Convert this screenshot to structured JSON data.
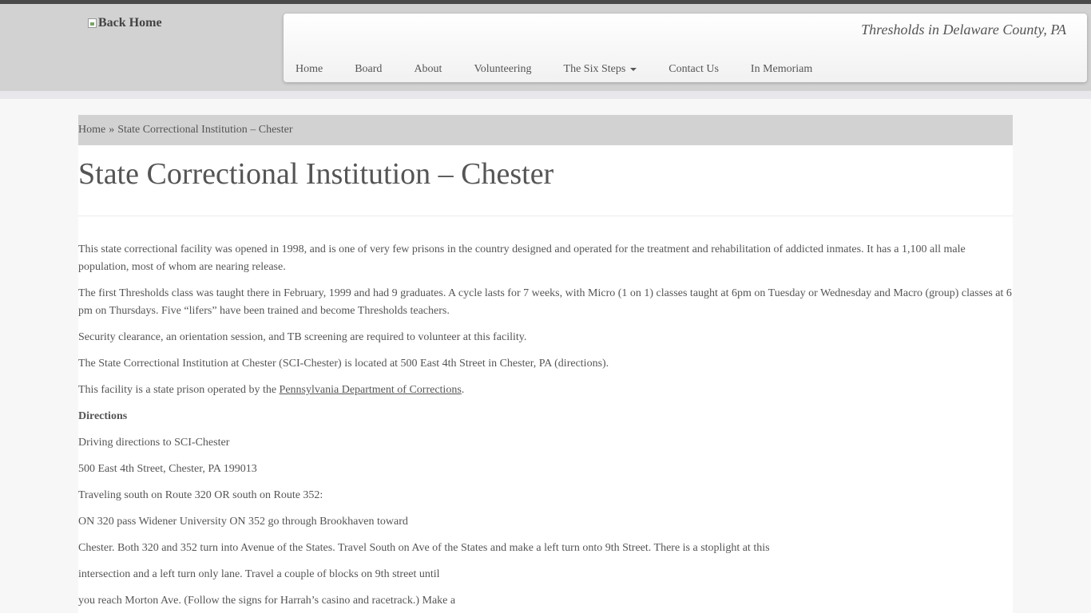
{
  "header": {
    "logo_alt": "Back Home",
    "tagline": "Thresholds in Delaware County, PA"
  },
  "nav": {
    "items": [
      {
        "label": "Home"
      },
      {
        "label": "Board"
      },
      {
        "label": "About"
      },
      {
        "label": "Volunteering"
      },
      {
        "label": "The Six Steps"
      },
      {
        "label": "Contact Us"
      },
      {
        "label": "In Memoriam"
      }
    ]
  },
  "breadcrumb": {
    "home": "Home",
    "separator": "»",
    "current": "State Correctional Institution – Chester"
  },
  "page": {
    "title": "State Correctional Institution – Chester",
    "paragraphs": {
      "p1": "This state correctional facility was opened in 1998, and is one of very few prisons in the country designed and operated for the treatment and rehabilitation of addicted inmates. It has a 1,100 all male population, most of whom are nearing release.",
      "p2": "The first Thresholds class was taught there in February, 1999 and had 9 graduates. A cycle lasts for 7 weeks, with Micro (1 on 1) classes taught at 6pm on Tuesday or Wednesday and Macro (group) classes at 6 pm on Thursdays. Five “lifers” have been trained and become Thresholds teachers.",
      "p3": "Security clearance, an orientation session, and TB screening are required to volunteer at this facility.",
      "p4": "The State Correctional Institution at Chester (SCI-Chester) is located at 500 East 4th Street in Chester, PA (directions).",
      "p5_prefix": "This facility is a state prison operated by the ",
      "p5_link": "Pennsylvania Department of Corrections",
      "p5_suffix": ".",
      "directions_heading": "Directions",
      "d1": "Driving directions to SCI-Chester",
      "d2": "500 East 4th Street, Chester, PA 199013",
      "d3": "Traveling south on Route 320 OR south on Route 352:",
      "d4": "ON 320 pass Widener University ON 352 go through Brookhaven toward",
      "d5": "Chester. Both 320 and 352 turn into Avenue of the States. Travel South on Ave of the States and make a left turn onto 9th Street. There is a stoplight at this",
      "d6": "intersection and a left turn only lane. Travel a couple of blocks on 9th street until",
      "d7": "you reach Morton Ave. (Follow the signs for Harrah’s casino and racetrack.) Make a"
    }
  },
  "colors": {
    "header_bg": "#d2d2d2",
    "top_strip": "#4a4a4a",
    "text": "#555555",
    "breadcrumb_bg": "#d2d2d2"
  }
}
